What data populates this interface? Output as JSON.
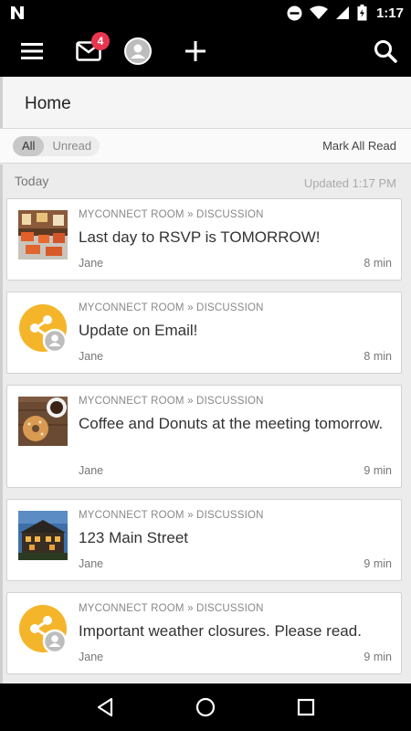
{
  "status": {
    "time": "1:17"
  },
  "appbar": {
    "unread_count": "4"
  },
  "page": {
    "title": "Home"
  },
  "filters": {
    "all": "All",
    "unread": "Unread",
    "mark_all": "Mark All Read"
  },
  "section": {
    "label": "Today",
    "updated": "Updated 1:17 PM"
  },
  "items": [
    {
      "crumb": "MYCONNECT ROOM » DISCUSSION",
      "title": "Last day to RSVP is TOMORROW!",
      "author": "Jane",
      "age": "8 min",
      "thumb": "restaurant-photo"
    },
    {
      "crumb": "MYCONNECT ROOM » DISCUSSION",
      "title": "Update on Email!",
      "author": "Jane",
      "age": "8 min",
      "thumb": "share-icon"
    },
    {
      "crumb": "MYCONNECT ROOM » DISCUSSION",
      "title": "Coffee and Donuts at the meeting tomorrow.",
      "author": "Jane",
      "age": "9 min",
      "thumb": "coffee-donut-photo"
    },
    {
      "crumb": "MYCONNECT ROOM » DISCUSSION",
      "title": "123 Main Street",
      "author": "Jane",
      "age": "9 min",
      "thumb": "house-photo"
    },
    {
      "crumb": "MYCONNECT ROOM » DISCUSSION",
      "title": "Important weather closures. Please read.",
      "author": "Jane",
      "age": "9 min",
      "thumb": "share-icon"
    }
  ],
  "colors": {
    "badge": "#e8364f",
    "share_orange": "#f5b52a",
    "bar": "#000000"
  }
}
